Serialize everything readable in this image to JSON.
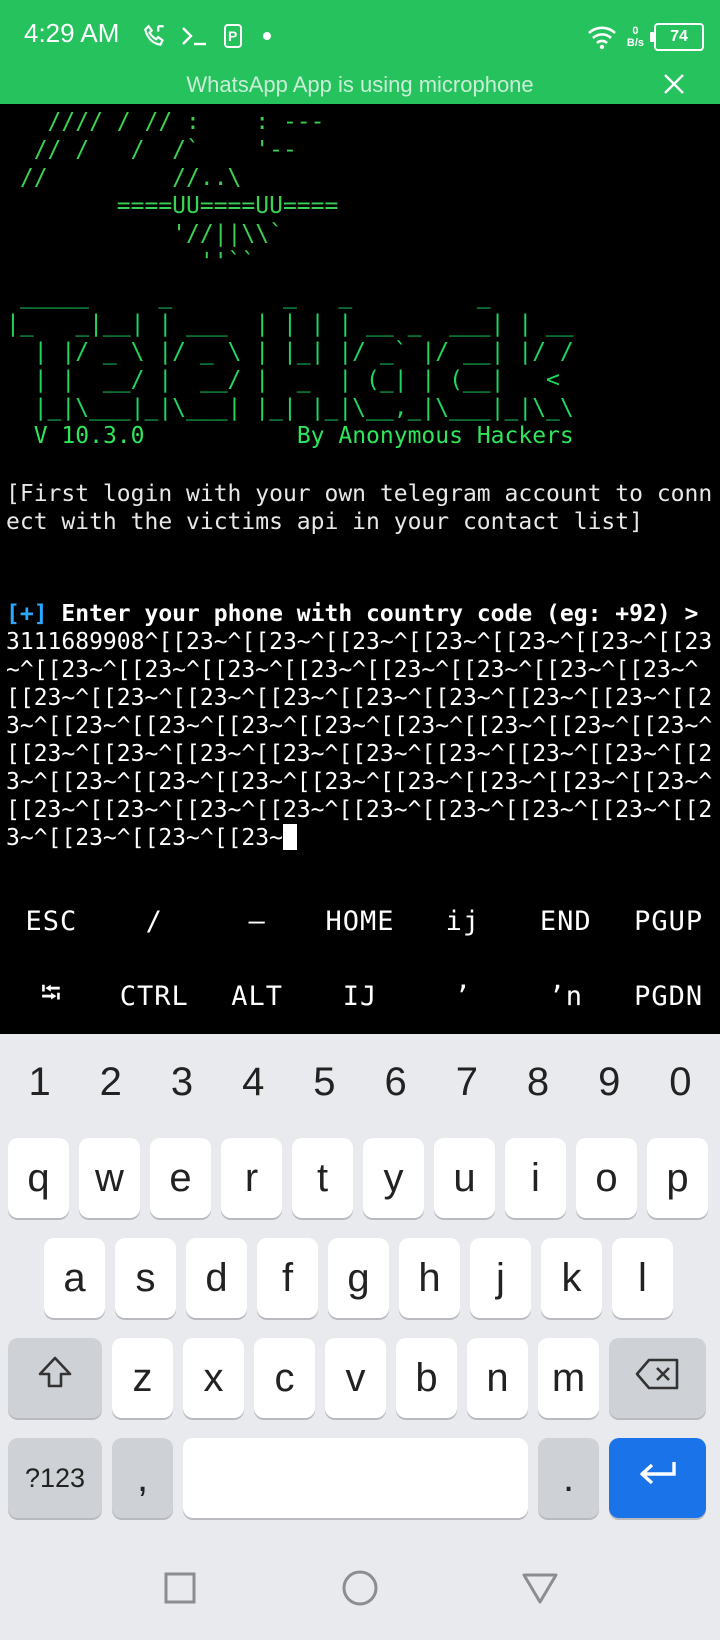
{
  "status_bar": {
    "time": "4:29 AM",
    "left_icons": [
      "phone-call-icon",
      "terminal-icon",
      "parking-icon",
      "dot-icon"
    ],
    "net_speed_value": "0",
    "net_speed_unit": "B/s",
    "battery": "74",
    "background": "#25c25e"
  },
  "mic_banner": {
    "text": "WhatsApp App is using microphone"
  },
  "terminal": {
    "ascii_art": "   //// / // :    : ---\n  // /   /  /`    '--\n //         //..\\\n        ====UU====UU====\n            '//||\\\\`\n              ''``",
    "logo": " _____     _        _   _         _\n|_   _|__| | ___  | | | | __ _  ___| | __\n  | |/ _ \\ |/ _ \\ | |_| |/ _` |/ __| |/ /\n  | |  __/ |  __/ |  _  | (_| | (__|   <\n  |_|\\___|_|\\___| |_| |_|\\__,_|\\___|_|\\_\\",
    "version": "V 10.3.0",
    "author": "By Anonymous Hackers",
    "note": "[First login with your own telegram account to connect with the victims api in your contact list]",
    "prompt_prefix": "[+]",
    "prompt_label": "Enter your phone with country code (eg: +92) >",
    "input_value": " 3111689908^[[23~^[[23~^[[23~^[[23~^[[23~^[[23~^[[23~^[[23~^[[23~^[[23~^[[23~^[[23~^[[23~^[[23~^[[23~^[[23~^[[23~^[[23~^[[23~^[[23~^[[23~^[[23~^[[23~^[[23~^[[23~^[[23~^[[23~^[[23~^[[23~^[[23~^[[23~^[[23~^[[23~^[[23~^[[23~^[[23~^[[23~^[[23~^[[23~^[[23~^[[23~^[[23~^[[23~^[[23~^[[23~^[[23~^[[23~^[[23~^[[23~^[[23~^[[23~^[[23~^[[23~^[[23~^[[23~^[[23~^[[23~^[[23~^[[23~^[[23~^[[23~"
  },
  "extra_keys": {
    "row1": [
      "ESC",
      "/",
      "—",
      "HOME",
      "ij",
      "END",
      "PGUP"
    ],
    "row2": [
      "⭾",
      "CTRL",
      "ALT",
      "IJ",
      "’",
      "ʼn",
      "PGDN"
    ]
  },
  "keyboard": {
    "numbers": [
      "1",
      "2",
      "3",
      "4",
      "5",
      "6",
      "7",
      "8",
      "9",
      "0"
    ],
    "row1": [
      "q",
      "w",
      "e",
      "r",
      "t",
      "y",
      "u",
      "i",
      "o",
      "p"
    ],
    "row2": [
      "a",
      "s",
      "d",
      "f",
      "g",
      "h",
      "j",
      "k",
      "l"
    ],
    "row3": [
      "z",
      "x",
      "c",
      "v",
      "b",
      "n",
      "m"
    ],
    "symbols_label": "?123",
    "comma": ",",
    "period": ".",
    "enter_color": "#1a73e8"
  },
  "nav_bar": {
    "buttons": [
      "recents-square-icon",
      "home-circle-icon",
      "back-triangle-icon"
    ]
  }
}
